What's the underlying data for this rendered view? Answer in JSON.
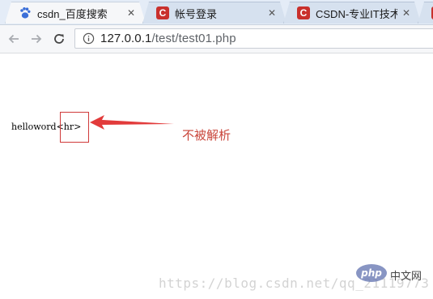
{
  "tabs": [
    {
      "title": "csdn_百度搜索",
      "icon": "baidu-paw-icon",
      "active": true
    },
    {
      "title": "帐号登录",
      "icon": "csdn-logo-icon",
      "active": false
    },
    {
      "title": "CSDN-专业IT技术社",
      "icon": "csdn-logo-icon",
      "active": false
    },
    {
      "title": "",
      "icon": "csdn-logo-icon",
      "active": false
    }
  ],
  "toolbar": {
    "url_host": "127.0.0.1",
    "url_path": "/test/test01.php"
  },
  "content": {
    "page_text": "helloword<hr>",
    "annotation": "不被解析"
  },
  "watermark": {
    "url_text": "https://blog.csdn.net/qq_21119773",
    "site_logo": "php",
    "site_name": "中文网"
  },
  "colors": {
    "annotation": "#c9453a",
    "csdn_brand": "#c9302c",
    "tab_bg": "#d6e1ef"
  }
}
